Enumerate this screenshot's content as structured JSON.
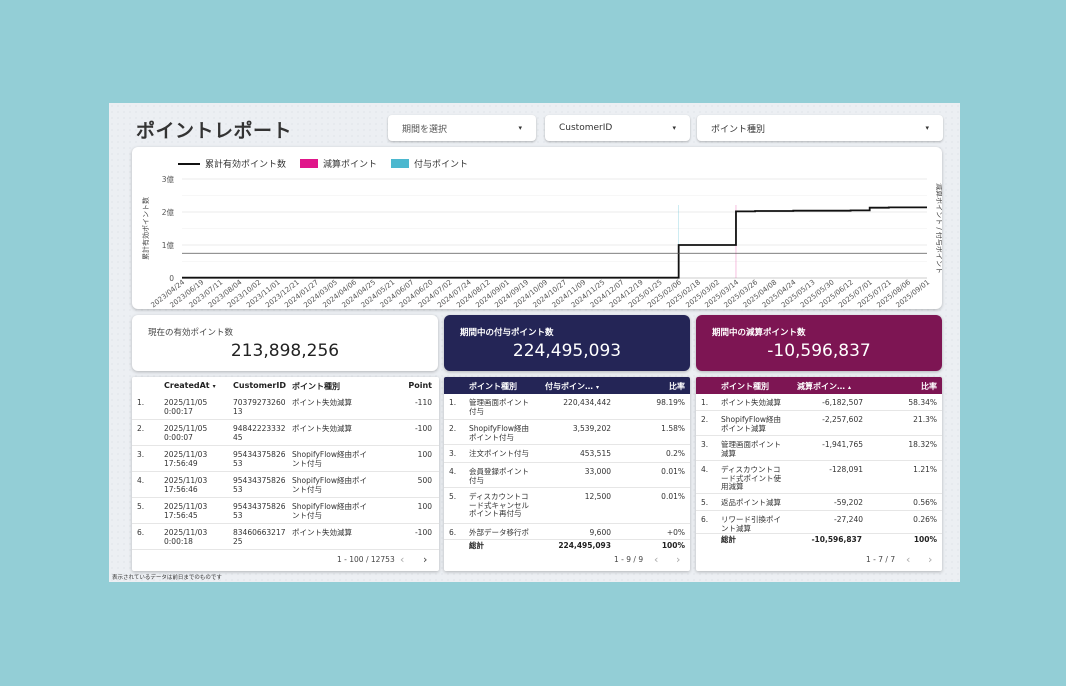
{
  "title": "ポイントレポート",
  "filters": [
    {
      "label": "期間を選択",
      "arrow": "▾"
    },
    {
      "label": "CustomerID",
      "arrow": "▾"
    },
    {
      "label": "ポイント種別",
      "arrow": "▾"
    }
  ],
  "legend": [
    "累計有効ポイント数",
    "減算ポイント",
    "付与ポイント"
  ],
  "colors": {
    "accent_navy": "#242556",
    "accent_magenta": "#7d1553",
    "subtract": "#e0168a",
    "grant": "#4cb8cf",
    "line": "#111111"
  },
  "kpis": [
    {
      "label": "現在の有効ポイント数",
      "value": "213,898,256"
    },
    {
      "label": "期間中の付与ポイント数",
      "value": "224,495,093"
    },
    {
      "label": "期間中の減算ポイント数",
      "value": "-10,596,837"
    }
  ],
  "chart_data": {
    "type": "line",
    "ylabel_left": "累計有効ポイント数",
    "ylabel_right": "減算ポイント / 付与ポイント",
    "y_ticks": [
      "0",
      "1億",
      "2億",
      "3億"
    ],
    "ylim": [
      0,
      3
    ],
    "x": [
      "2023/04/24",
      "2023/06/19",
      "2023/07/11",
      "2023/08/04",
      "2023/10/02",
      "2023/11/01",
      "2023/12/21",
      "2024/01/27",
      "2024/03/05",
      "2024/04/06",
      "2024/04/25",
      "2024/05/21",
      "2024/06/07",
      "2024/06/20",
      "2024/07/02",
      "2024/07/24",
      "2024/08/12",
      "2024/09/01",
      "2024/09/19",
      "2024/10/09",
      "2024/10/27",
      "2024/11/09",
      "2024/11/25",
      "2024/12/07",
      "2024/12/19",
      "2025/01/25",
      "2025/02/06",
      "2025/02/18",
      "2025/03/02",
      "2025/03/14",
      "2025/03/26",
      "2025/04/08",
      "2025/04/24",
      "2025/05/13",
      "2025/05/30",
      "2025/06/12",
      "2025/07/01",
      "2025/07/21",
      "2025/08/06",
      "2025/09/01"
    ],
    "series": [
      {
        "name": "累計有効ポイント数",
        "values": [
          0.01,
          0.01,
          0.01,
          0.01,
          0.01,
          0.01,
          0.01,
          0.01,
          0.01,
          0.01,
          0.01,
          0.01,
          0.01,
          0.01,
          0.01,
          0.01,
          0.01,
          0.01,
          0.01,
          0.01,
          0.01,
          0.01,
          0.01,
          0.01,
          0.01,
          0.01,
          1.0,
          1.0,
          1.0,
          2.02,
          2.03,
          2.03,
          2.04,
          2.04,
          2.04,
          2.05,
          2.13,
          2.14,
          2.14,
          2.14
        ]
      }
    ]
  },
  "table1": {
    "headers": [
      "CreatedAt",
      "CustomerID",
      "ポイント種別",
      "Point"
    ],
    "sort_icon": "▾",
    "rows": [
      {
        "idx": "1.",
        "date": "2025/11/05",
        "time": "0:00:17",
        "cid": "70379273260",
        "cid2": "13",
        "type": "ポイント失効減算",
        "type2": "",
        "point": "-110"
      },
      {
        "idx": "2.",
        "date": "2025/11/05",
        "time": "0:00:07",
        "cid": "94842223332",
        "cid2": "45",
        "type": "ポイント失効減算",
        "type2": "",
        "point": "-100"
      },
      {
        "idx": "3.",
        "date": "2025/11/03",
        "time": "17:56:49",
        "cid": "95434375826",
        "cid2": "53",
        "type": "ShopifyFlow経由ポイ",
        "type2": "ント付与",
        "point": "100"
      },
      {
        "idx": "4.",
        "date": "2025/11/03",
        "time": "17:56:46",
        "cid": "95434375826",
        "cid2": "53",
        "type": "ShopifyFlow経由ポイ",
        "type2": "ント付与",
        "point": "500"
      },
      {
        "idx": "5.",
        "date": "2025/11/03",
        "time": "17:56:45",
        "cid": "95434375826",
        "cid2": "53",
        "type": "ShopifyFlow経由ポイ",
        "type2": "ント付与",
        "point": "100"
      },
      {
        "idx": "6.",
        "date": "2025/11/03",
        "time": "0:00:18",
        "cid": "83460663217",
        "cid2": "25",
        "type": "ポイント失効減算",
        "type2": "",
        "point": "-100"
      }
    ],
    "pager": "1 - 100 / 12753",
    "prev": "‹",
    "next": "›"
  },
  "table2": {
    "headers": [
      "ポイント種別",
      "付与ポイン…",
      "比率"
    ],
    "sort_icon": "▾",
    "rows": [
      {
        "idx": "1.",
        "type": "管理画面ポイント",
        "type2": "付与",
        "type3": "",
        "value": "220,434,442",
        "ratio": "98.19%"
      },
      {
        "idx": "2.",
        "type": "ShopifyFlow経由",
        "type2": "ポイント付与",
        "type3": "",
        "value": "3,539,202",
        "ratio": "1.58%"
      },
      {
        "idx": "3.",
        "type": "注文ポイント付与",
        "type2": "",
        "type3": "",
        "value": "453,515",
        "ratio": "0.2%"
      },
      {
        "idx": "4.",
        "type": "会員登録ポイント",
        "type2": "付与",
        "type3": "",
        "value": "33,000",
        "ratio": "0.01%"
      },
      {
        "idx": "5.",
        "type": "ディスカウントコ",
        "type2": "ード式キャンセル",
        "type3": "ポイント再付与",
        "value": "12,500",
        "ratio": "0.01%"
      },
      {
        "idx": "6.",
        "type": "外部データ移行ポ",
        "type2": "",
        "type3": "",
        "value": "9,600",
        "ratio": "+0%"
      }
    ],
    "total_label": "総計",
    "total_value": "224,495,093",
    "total_ratio": "100%",
    "pager": "1 - 9 / 9",
    "prev": "‹",
    "next": "›"
  },
  "table3": {
    "headers": [
      "ポイント種別",
      "減算ポイン…",
      "比率"
    ],
    "sort_icon": "▴",
    "rows": [
      {
        "idx": "1.",
        "type": "ポイント失効減算",
        "type2": "",
        "type3": "",
        "value": "-6,182,507",
        "ratio": "58.34%"
      },
      {
        "idx": "2.",
        "type": "ShopifyFlow経由",
        "type2": "ポイント減算",
        "type3": "",
        "value": "-2,257,602",
        "ratio": "21.3%"
      },
      {
        "idx": "3.",
        "type": "管理画面ポイント",
        "type2": "減算",
        "type3": "",
        "value": "-1,941,765",
        "ratio": "18.32%"
      },
      {
        "idx": "4.",
        "type": "ディスカウントコ",
        "type2": "ード式ポイント使",
        "type3": "用減算",
        "value": "-128,091",
        "ratio": "1.21%"
      },
      {
        "idx": "5.",
        "type": "返品ポイント減算",
        "type2": "",
        "type3": "",
        "value": "-59,202",
        "ratio": "0.56%"
      },
      {
        "idx": "6.",
        "type": "リワード引換ポイ",
        "type2": "ント減算",
        "type3": "",
        "value": "-27,240",
        "ratio": "0.26%"
      }
    ],
    "total_label": "総計",
    "total_value": "-10,596,837",
    "total_ratio": "100%",
    "pager": "1 - 7 / 7",
    "prev": "‹",
    "next": "›"
  },
  "footnote": "表示されているデータは前日までのものです"
}
